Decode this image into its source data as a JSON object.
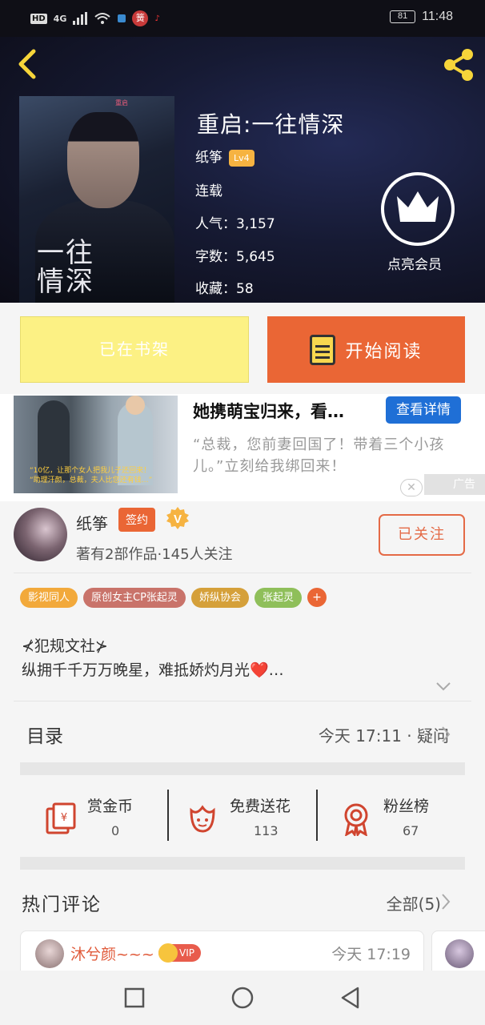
{
  "status_bar": {
    "hd": "HD",
    "network": "4G",
    "battery": "81",
    "time": "11:48"
  },
  "header": {
    "back_icon": "chevron-left-icon",
    "share_icon": "share-icon"
  },
  "book": {
    "title": "重启:一往情深",
    "cover_title": "一往\n情深",
    "cover_corner": "重启",
    "author": "纸筝",
    "level": "Lv4",
    "status": "连载",
    "popularity_label": "人气：",
    "popularity": "3,157",
    "words_label": "字数：",
    "words": "5,645",
    "favorites_label": "收藏：",
    "favorites": "58",
    "vip_label": "点亮会员"
  },
  "actions": {
    "shelf_label": "已在书架",
    "read_label": "开始阅读"
  },
  "ad": {
    "title": "她携萌宝归来，看…",
    "button": "查看详情",
    "description": "“总裁，您前妻回国了！带着三个小孩儿。”立刻给我绑回来！",
    "close": "✕",
    "label": "广告",
    "image_caption_1": "“10亿，让那个女人把我儿子还回来！",
    "image_caption_2": "“助理汗颜，总裁，夫人比您还有钱…”"
  },
  "author_section": {
    "name": "纸筝",
    "sign_badge": "签约",
    "v_badge": "V",
    "stats": "著有2部作品·145人关注",
    "follow_button": "已关注"
  },
  "tags": [
    {
      "label": "影视同人",
      "color": "#f2a93b"
    },
    {
      "label": "原创女主CP张起灵",
      "color": "#c9736a"
    },
    {
      "label": "娇纵协会",
      "color": "#d5a03a"
    },
    {
      "label": "张起灵",
      "color": "#8fbf5a"
    }
  ],
  "tag_more": "+",
  "intro": {
    "line1": "⊀犯规文社⊁",
    "line2": "纵拥千千万万晚星，难抵娇灼月光❤️…"
  },
  "directory": {
    "title": "目录",
    "meta": "今天 17:11 · 疑问"
  },
  "stats": [
    {
      "label": "赏金币",
      "value": "0",
      "icon": "red-envelope-icon"
    },
    {
      "label": "免费送花",
      "value": "113",
      "icon": "flower-icon"
    },
    {
      "label": "粉丝榜",
      "value": "67",
      "icon": "medal-icon"
    }
  ],
  "hot_comments": {
    "title": "热门评论",
    "all_label": "全部(5)"
  },
  "comment": {
    "user": "沐兮颜~~~",
    "vip": "VIP",
    "time": "今天 17:19"
  },
  "colors": {
    "accent_orange": "#ea6635",
    "shelf_yellow": "#fcf184",
    "ad_blue": "#1f6fd6",
    "vip_gold": "#f6b341"
  }
}
